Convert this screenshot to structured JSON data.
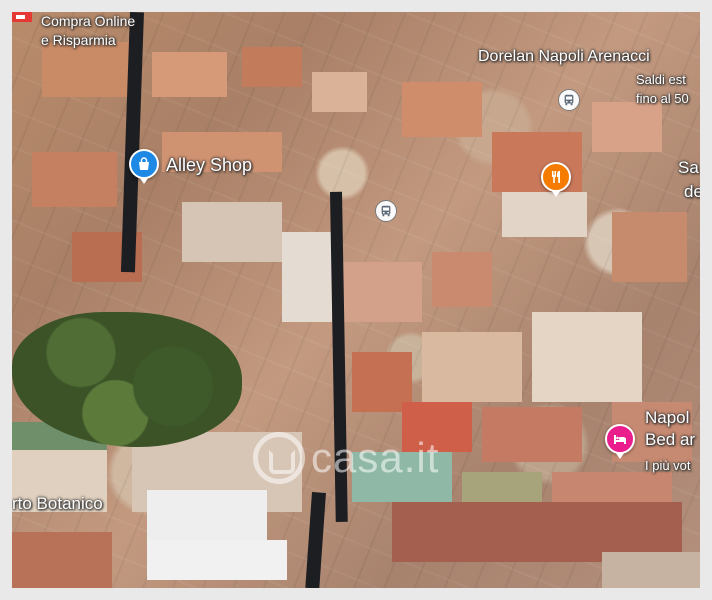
{
  "labels": {
    "compra_line1": "Compra Online",
    "compra_line2": "e Risparmia",
    "dorelan_title": "Dorelan Napoli Arenacci",
    "dorelan_line2": "Saldi est",
    "dorelan_line3": "fino al 50",
    "alley_shop": "Alley Shop",
    "right_edge_1": "Sa",
    "right_edge_2": "de",
    "napoli_line1": "Napol",
    "napoli_line2": "Bed ar",
    "napoli_line3": "I più vot",
    "orto_botanico": "rto Botanico",
    "watermark": "casa.it"
  },
  "icons": {
    "shopping_pin": "shopping-bag-icon",
    "restaurant_pin": "fork-knife-icon",
    "lodging_pin": "bed-icon",
    "transit_stop": "bus-icon",
    "ad_badge": "ad-flag-icon"
  },
  "colors": {
    "shopping_pin": "#1e88e5",
    "restaurant_pin": "#f57c00",
    "lodging_pin": "#e91e8c",
    "transit_bg": "#fafafa",
    "label_text": "#ffffff",
    "ad_badge": "#e53935"
  }
}
